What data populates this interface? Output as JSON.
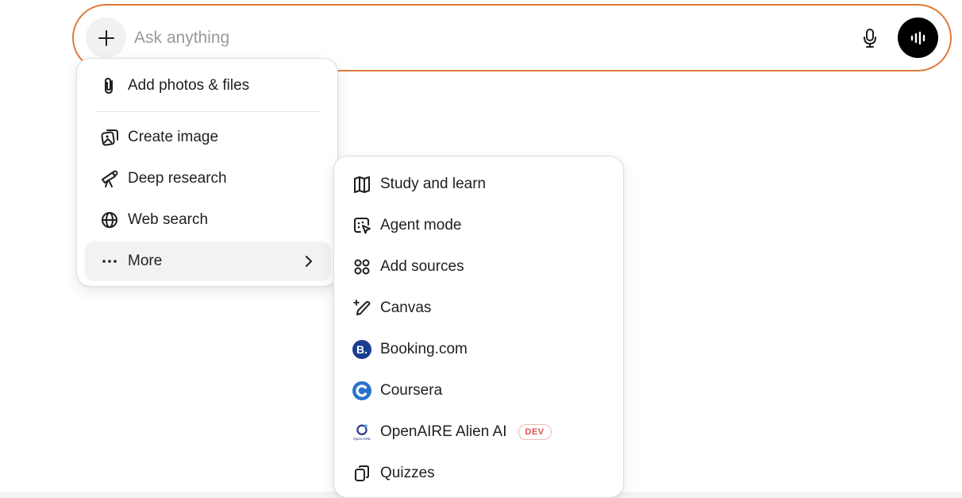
{
  "composer": {
    "placeholder": "Ask anything",
    "value": "",
    "plus_icon": "plus-icon",
    "mic_icon": "microphone-icon",
    "voice_icon": "voice-waveform-icon",
    "border_color": "#e07a3a"
  },
  "main_menu": {
    "items": [
      {
        "label": "Add photos & files",
        "icon": "paperclip-icon"
      },
      {
        "label": "Create image",
        "icon": "image-icon"
      },
      {
        "label": "Deep research",
        "icon": "telescope-icon"
      },
      {
        "label": "Web search",
        "icon": "globe-icon"
      },
      {
        "label": "More",
        "icon": "ellipsis-icon",
        "active": true
      }
    ]
  },
  "more_menu": {
    "items": [
      {
        "label": "Study and learn",
        "icon": "book-icon"
      },
      {
        "label": "Agent mode",
        "icon": "agent-cursor-icon"
      },
      {
        "label": "Add sources",
        "icon": "connectors-icon"
      },
      {
        "label": "Canvas",
        "icon": "pencil-sparkle-icon"
      },
      {
        "label": "Booking.com",
        "icon": "booking-logo-icon",
        "color": "#1a3d8f"
      },
      {
        "label": "Coursera",
        "icon": "coursera-logo-icon",
        "color": "#2a73cc"
      },
      {
        "label": "OpenAIRE Alien AI",
        "icon": "openaire-logo-icon",
        "badge": "DEV",
        "logo_text": "OpenAIRE"
      },
      {
        "label": "Quizzes",
        "icon": "cards-icon"
      }
    ]
  }
}
